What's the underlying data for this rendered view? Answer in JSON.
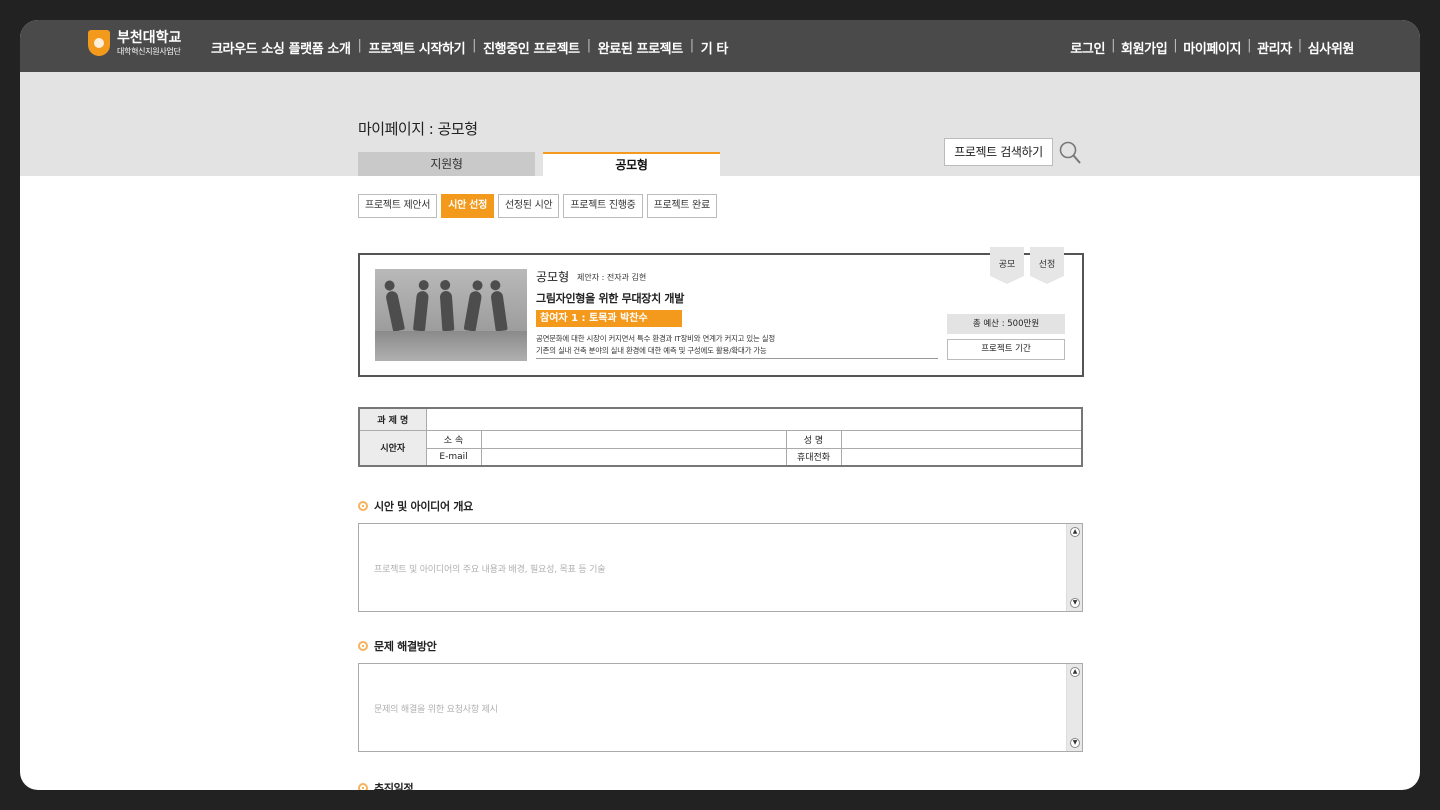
{
  "header": {
    "logo_name": "부천대학교",
    "logo_sub": "대학혁신지원사업단",
    "nav": [
      "크라우드 소싱 플랫폼 소개",
      "프로젝트 시작하기",
      "진행중인 프로젝트",
      "완료된 프로젝트",
      "기 타"
    ],
    "util": [
      "로그인",
      "회원가입",
      "마이페이지",
      "관리자",
      "심사위원"
    ]
  },
  "page": {
    "title": "마이페이지 : 공모형",
    "tabs": [
      "지원형",
      "공모형"
    ],
    "search_label": "프로젝트 검색하기"
  },
  "subtabs": [
    "프로젝트 제안서",
    "시안 선정",
    "선정된 시안",
    "프로젝트 진행중",
    "프로젝트 완료"
  ],
  "card": {
    "type": "공모형",
    "proposer": "제안자 : 전자과 김현",
    "title": "그림자인형을 위한 무대장치 개발",
    "participant": "참여자 1 : 토목과 박찬수",
    "desc_line1": "공연문화에 대한 시장이 커지면서 특수 환경과 IT장비와 연계가 커지고 있는 실정",
    "desc_line2": "기존의 실내 건축 분야의 실내 환경에 대한 예측 및 구성에도 활용/확대가 가능",
    "badges": [
      "공모",
      "선정"
    ],
    "budget": "총 예산 : 500만원",
    "period": "프로젝트 기간"
  },
  "info_table": {
    "task_name": "과 제 명",
    "proposer": "시안자",
    "affiliation": "소 속",
    "name": "성 명",
    "email": "E-mail",
    "phone": "휴대전화"
  },
  "sections": [
    {
      "title": "시안 및 아이디어 개요",
      "placeholder": "프로젝트 및 아이디어의 주요 내용과 배경, 필요성, 목표 등 기술"
    },
    {
      "title": "문제 해결방안",
      "placeholder": "문제의 해결을 위한 요청사항 제시"
    },
    {
      "title": "추진일정"
    }
  ],
  "colors": {
    "accent": "#f39a1c",
    "topbar": "#4a4a4a",
    "hero": "#e3e3e3"
  }
}
